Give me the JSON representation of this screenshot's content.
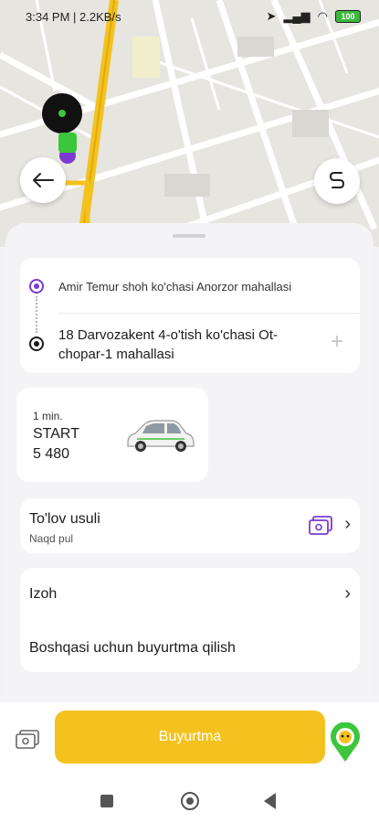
{
  "status_bar": {
    "time": "3:34 PM",
    "speed": "2.2KB/s",
    "battery": "100"
  },
  "map": {
    "pin_color": "#3cc63c",
    "road_color": "#f4c21e"
  },
  "route": {
    "from": "Amir Temur shoh ko'chasi Anorzor mahallasi",
    "to": "18 Darvozakent 4-o'tish ko'chasi Ot-chopar-1 mahallasi",
    "add_stop": "+"
  },
  "tariff": {
    "eta": "1 min.",
    "name": "START",
    "price": "5 480"
  },
  "payment": {
    "title": "To'lov usuli",
    "method": "Naqd pul"
  },
  "extras": {
    "comment": "Izoh",
    "order_for_other": "Boshqasi uchun buyurtma qilish"
  },
  "order_button": {
    "label": "Buyurtma"
  },
  "colors": {
    "accent": "#f4c21e",
    "purple": "#7a3bd1",
    "green": "#3cc63c"
  }
}
